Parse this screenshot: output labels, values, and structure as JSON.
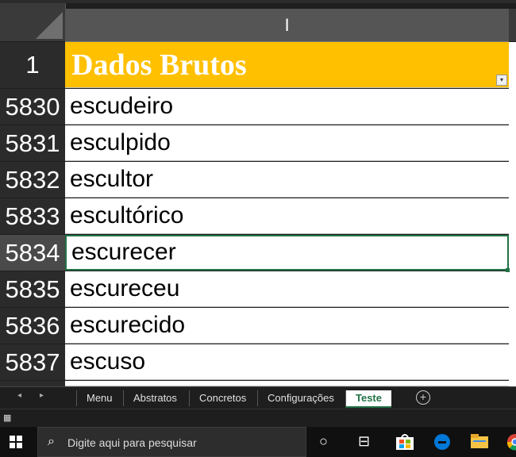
{
  "column_header": "I",
  "header_row": {
    "row_number": "1",
    "title": "Dados Brutos",
    "filter_glyph": "▾"
  },
  "rows": [
    {
      "row_number": "5830",
      "value": "escudeiro"
    },
    {
      "row_number": "5831",
      "value": "esculpido"
    },
    {
      "row_number": "5832",
      "value": "escultor"
    },
    {
      "row_number": "5833",
      "value": "escultórico"
    },
    {
      "row_number": "5834",
      "value": "escurecer"
    },
    {
      "row_number": "5835",
      "value": "escureceu"
    },
    {
      "row_number": "5836",
      "value": "escurecido"
    },
    {
      "row_number": "5837",
      "value": "escuso"
    }
  ],
  "sheet_tabs": {
    "prev_arrow": "◂",
    "next_arrow": "▸",
    "tabs": [
      "Menu",
      "Abstratos",
      "Concretos",
      "Configurações",
      "Teste"
    ],
    "active": "Teste",
    "add_glyph": "+"
  },
  "statusbar": {
    "icon_glyph": "▦"
  },
  "taskbar": {
    "search_placeholder": "Digite aqui para pesquisar",
    "search_glyph": "⌕",
    "cortana_glyph": "○",
    "taskview_glyph": "⊟"
  },
  "colors": {
    "header_fill": "#ffc000",
    "accent": "#217346"
  }
}
